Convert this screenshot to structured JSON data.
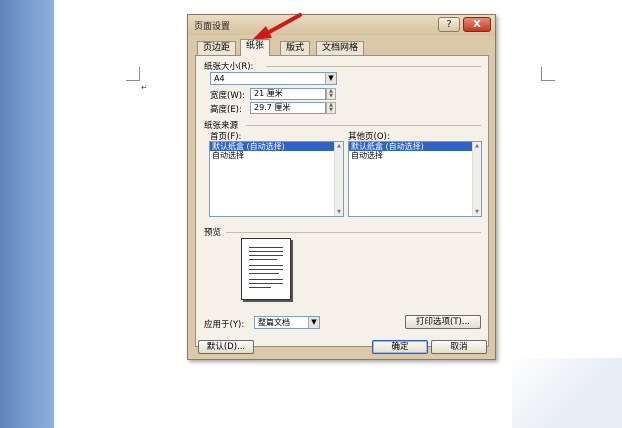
{
  "dialog": {
    "title": "页面设置",
    "help_label": "?",
    "close_label": "X",
    "tabs": [
      {
        "label": "页边距"
      },
      {
        "label": "纸张"
      },
      {
        "label": "版式"
      },
      {
        "label": "文档网格"
      }
    ]
  },
  "paper_size": {
    "group_label": "纸张大小(R):",
    "selected": "A4",
    "width_label": "宽度(W):",
    "width_value": "21 厘米",
    "height_label": "高度(E):",
    "height_value": "29.7 厘米"
  },
  "paper_source": {
    "group_label": "纸张来源",
    "first_page_label": "首页(F):",
    "first_page_items": [
      "默认纸盒 (自动选择)",
      "自动选择"
    ],
    "other_pages_label": "其他页(O):",
    "other_pages_items": [
      "默认纸盒 (自动选择)",
      "自动选择"
    ]
  },
  "preview": {
    "group_label": "预览",
    "apply_to_label": "应用于(Y):",
    "apply_to_value": "整篇文档",
    "print_options_label": "打印选项(T)..."
  },
  "footer": {
    "default_label": "默认(D)...",
    "ok_label": "确定",
    "cancel_label": "取消"
  },
  "document": {
    "paragraph_mark": "↵"
  }
}
